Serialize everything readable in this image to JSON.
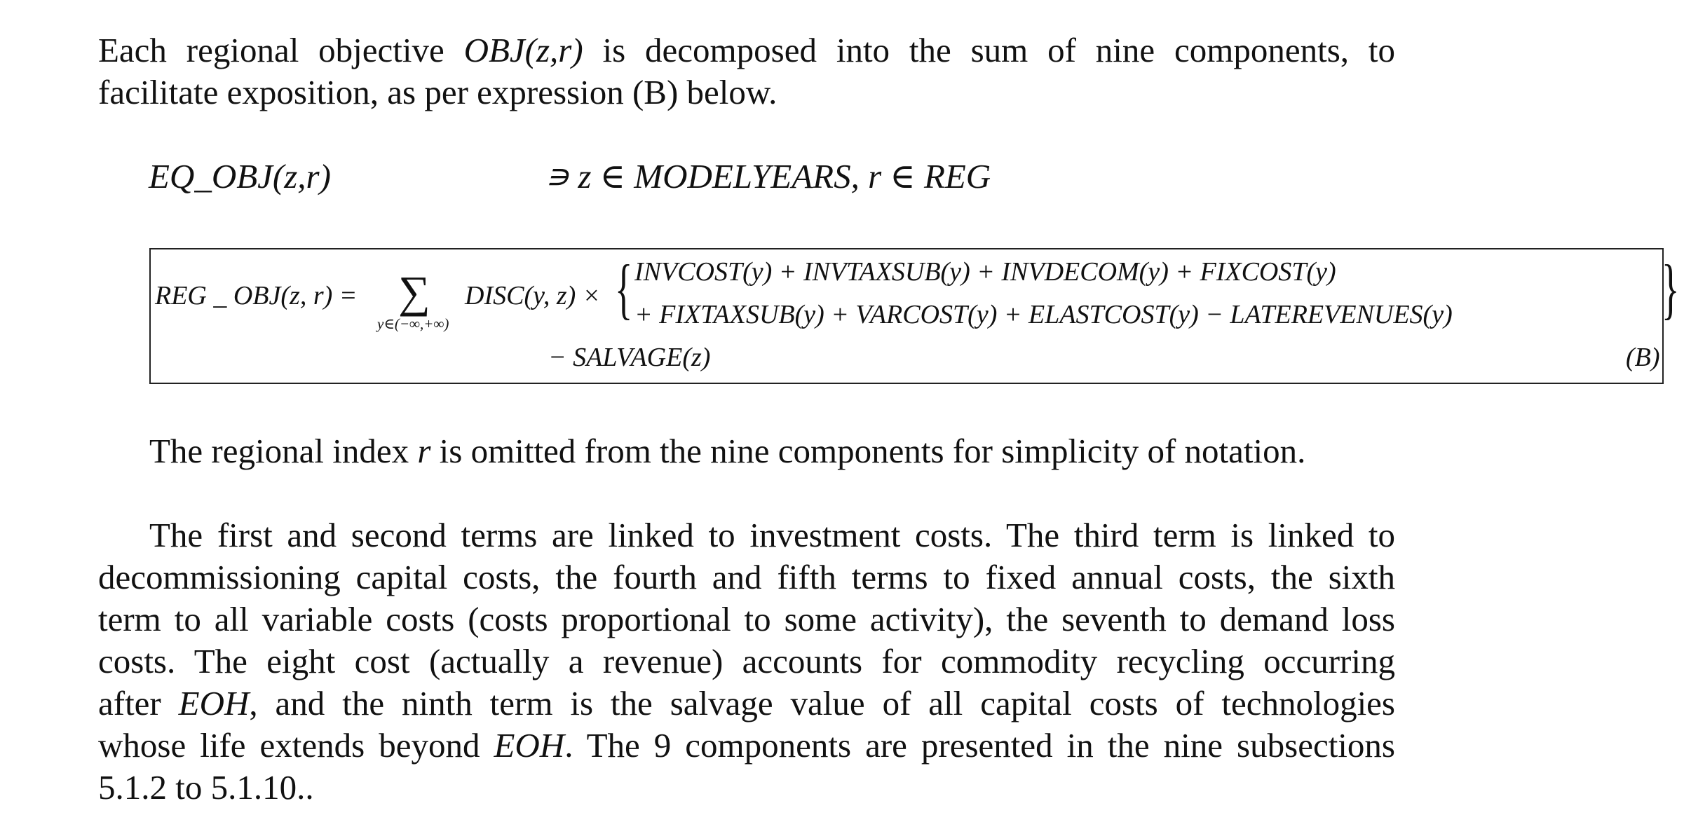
{
  "paragraph1": {
    "line1_a": "Each regional objective ",
    "line1_obj": "OBJ(z,r)",
    "line1_b": " is decomposed into the sum of nine components, to",
    "line2": "facilitate exposition, as per expression (B) below."
  },
  "equation_header": {
    "name": "EQ_OBJ(z,r)",
    "condition": "∍ z ∈ MODELYEARS, r ∈ REG"
  },
  "formula": {
    "lhs": "REG _ OBJ(z, r) =",
    "sum_symbol": "∑",
    "sum_subscript": "y∈(−∞,+∞)",
    "disc": "DISC(y, z) ×",
    "brace_left": "{",
    "row1": "INVCOST(y) + INVTAXSUB(y) + INVDECOM(y) + FIXCOST(y)",
    "row2": "+ FIXTAXSUB(y) + VARCOST(y) + ELASTCOST(y) − LATEREVENUES(y)",
    "brace_right": "}",
    "row3": "− SALVAGE(z)",
    "label": "(B)"
  },
  "paragraph2": {
    "a": "The regional index ",
    "r": "r",
    "b": " is omitted from the nine components for simplicity of notation."
  },
  "paragraph3": {
    "line1": "The first and second terms are linked to investment costs. The third term is linked to",
    "line2": "decommissioning capital costs, the fourth and fifth terms to fixed annual costs, the sixth",
    "line3": "term to all variable costs (costs proportional to some activity), the seventh to demand loss",
    "line4": "costs. The eight cost (actually a revenue) accounts for commodity recycling occurring",
    "line5_a": "after ",
    "line5_eoh": "EOH",
    "line5_b": ", and the ninth term is the salvage value of all capital costs of technologies",
    "line6_a": "whose life extends beyond ",
    "line6_eoh": "EOH",
    "line6_b": ". The 9 components are presented in the nine subsections",
    "line7": "5.1.2 to 5.1.10.."
  }
}
